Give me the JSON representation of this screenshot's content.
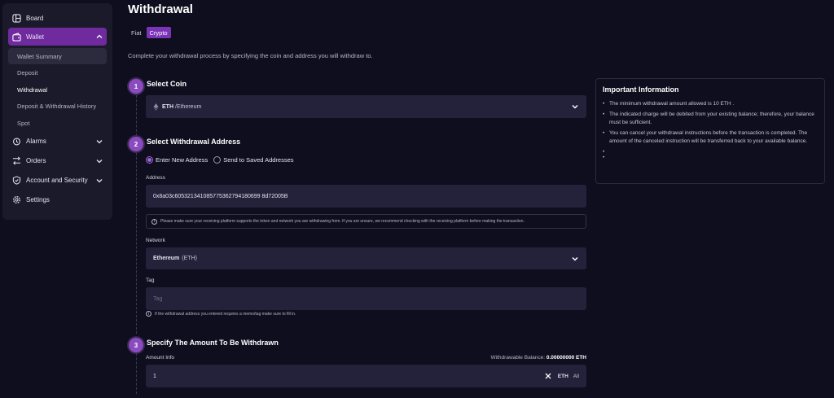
{
  "sidebar": {
    "board": "Board",
    "wallet": "Wallet",
    "wallet_items": [
      "Wallet Summary",
      "Deposit",
      "Withdrawal",
      "Deposit & Withdrawal History",
      "Spot"
    ],
    "alarms": "Alarms",
    "orders": "Orders",
    "account": "Account and Security",
    "settings": "Settings"
  },
  "page": {
    "title": "Withdrawal",
    "tabs": [
      "Fiat",
      "Crypto"
    ],
    "active_tab": "Crypto",
    "intro": "Complete your withdrawal process by specifying the coin and address you will withdraw to."
  },
  "step1": {
    "number": "1",
    "title": "Select Coin",
    "coin_symbol": "ETH",
    "coin_name": "/Ethereum"
  },
  "step2": {
    "number": "2",
    "title": "Select Withdrawal Address",
    "radio_new": "Enter New Address",
    "radio_saved": "Send to Saved Addresses",
    "address_label": "Address",
    "address_value": "0x8a03c605321341085775362794180699 8d72005B",
    "address_note": "Please make sure your receiving platform supports the token and network you are withdrawing from. If you are unsure, we recommend checking with the receiving platform before making the transaction.",
    "network_label": "Network",
    "network_name": "Ethereum",
    "network_code": "(ETH)",
    "tag_label": "Tag",
    "tag_placeholder": "Tag",
    "tag_hint": "If the withdrawal address you entered requires a memo/tag make sure to fill in."
  },
  "step3": {
    "number": "3",
    "title": "Specify The Amount To Be Withdrawn",
    "amount_label": "Amount Info",
    "balance_label": "Withdrawable Balance:",
    "balance_value": "0.00000000 ETH",
    "amount_value": "1",
    "currency": "ETH",
    "all_label": "All"
  },
  "info": {
    "title": "Important Information",
    "items": [
      "The minimum withdrawal amount allowed is 10 ETH .",
      "The indicated charge will be debited from your existing balance; therefore, your balance must be sufficient.",
      "You can cancel your withdrawal instructions before the transaction is completed. The amount of the canceled instruction will be transferred back to your available balance.",
      "",
      ""
    ]
  },
  "colors": {
    "background": "#0f0e1f",
    "sidebar": "#1b1a2b",
    "accent": "#7b33b8",
    "field": "#23223a"
  }
}
